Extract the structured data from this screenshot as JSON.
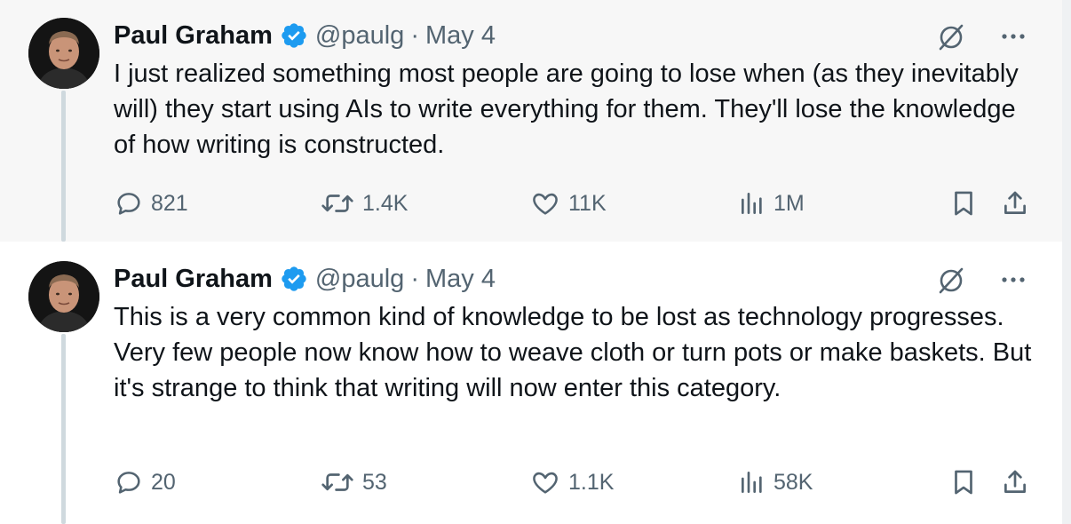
{
  "tweets": [
    {
      "name": "Paul Graham",
      "handle": "@paulg",
      "dot": "·",
      "date": "May 4",
      "text": "I just realized something most people are going to lose when (as they inevitably will) they start using AIs to write everything for them. They'll lose the knowledge of how writing is constructed.",
      "replies": "821",
      "retweets": "1.4K",
      "likes": "11K",
      "views": "1M"
    },
    {
      "name": "Paul Graham",
      "handle": "@paulg",
      "dot": "·",
      "date": "May 4",
      "text": "This is a very common kind of knowledge to be lost as technology progresses. Very few people now know how to weave cloth or turn pots or make baskets. But it's strange to think that writing will now enter this category.",
      "replies": "20",
      "retweets": "53",
      "likes": "1.1K",
      "views": "58K"
    }
  ],
  "icons": {
    "verified": "verified-badge-icon",
    "grok": "grok-icon",
    "more": "more-icon",
    "reply": "reply-icon",
    "retweet": "retweet-icon",
    "like": "heart-icon",
    "views": "views-icon",
    "bookmark": "bookmark-icon",
    "share": "share-icon"
  },
  "colors": {
    "verified": "#1d9bf0",
    "text": "#0f1419",
    "muted": "#536471",
    "thread_line": "#cfd9de",
    "highlight_bg": "#f7f7f7"
  }
}
